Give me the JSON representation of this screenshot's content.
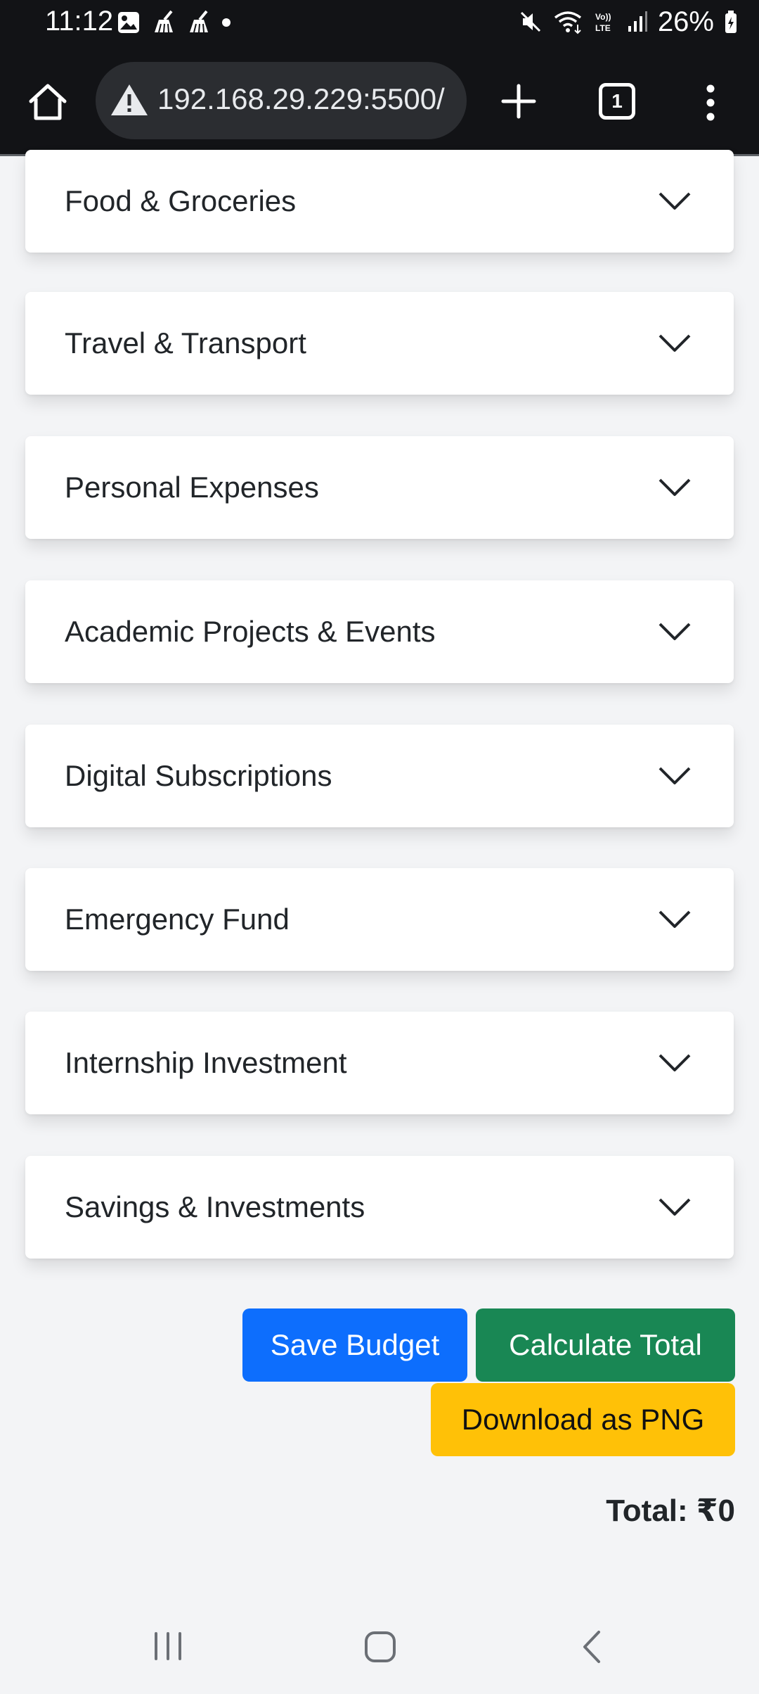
{
  "status_bar": {
    "time": "11:12",
    "battery": "26%",
    "left_icons": [
      "image-icon",
      "cleaner-icon",
      "cleaner-icon",
      "dot-icon"
    ],
    "right_icons": [
      "mute-icon",
      "wifi-icon",
      "volte-icon",
      "signal-icon",
      "battery-charging-icon"
    ]
  },
  "browser": {
    "url": "192.168.29.229:5500/",
    "tab_count": "1"
  },
  "accordion": {
    "items": [
      {
        "label": "Food & Groceries"
      },
      {
        "label": "Travel & Transport"
      },
      {
        "label": "Personal Expenses"
      },
      {
        "label": "Academic Projects & Events"
      },
      {
        "label": "Digital Subscriptions"
      },
      {
        "label": "Emergency Fund"
      },
      {
        "label": "Internship Investment"
      },
      {
        "label": "Savings & Investments"
      }
    ]
  },
  "actions": {
    "save_label": "Save Budget",
    "calculate_label": "Calculate Total",
    "download_label": "Download as PNG"
  },
  "total": {
    "text": "Total: ₹0"
  },
  "colors": {
    "primary": "#0d6efd",
    "success": "#198754",
    "warning": "#ffc107",
    "page_bg": "#f3f4f6",
    "chrome_bg": "#121316"
  }
}
